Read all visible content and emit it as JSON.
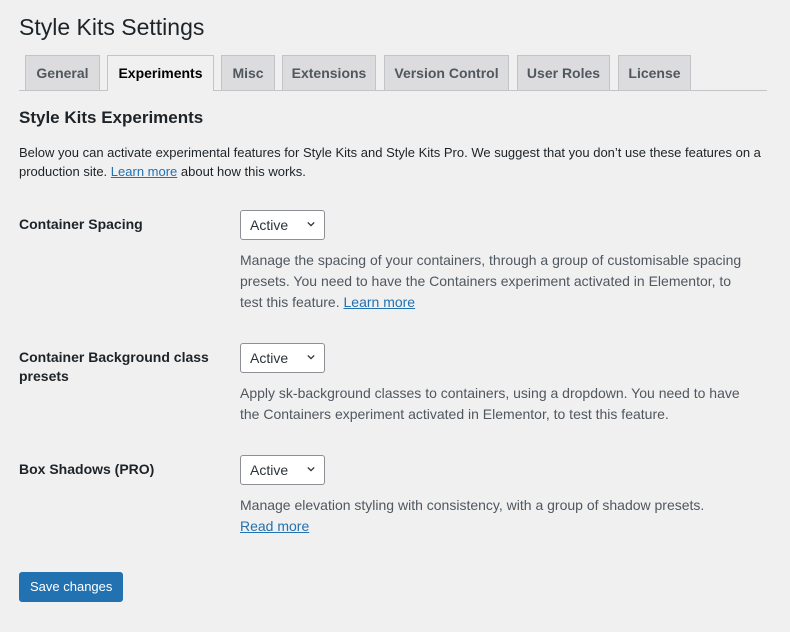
{
  "page": {
    "title": "Style Kits Settings"
  },
  "tabs": [
    {
      "label": "General"
    },
    {
      "label": "Experiments",
      "active": true
    },
    {
      "label": "Misc"
    },
    {
      "label": "Extensions"
    },
    {
      "label": "Version Control"
    },
    {
      "label": "User Roles"
    },
    {
      "label": "License"
    }
  ],
  "section": {
    "title": "Style Kits Experiments",
    "intro_text": "Below you can activate experimental features for Style Kits and Style Kits Pro. We suggest that you don’t use these features on a production site.",
    "intro_link": "Learn more",
    "intro_tail": "about how this works."
  },
  "settings": [
    {
      "label": "Container Spacing",
      "value": "Active",
      "description": "Manage the spacing of your containers, through a group of customisable spacing presets. You need to have the Containers experiment activated in Elementor, to test this feature.",
      "link": "Learn more"
    },
    {
      "label": "Container Background class presets",
      "value": "Active",
      "description": "Apply sk-background classes to containers, using a dropdown. You need to have the Containers experiment activated in Elementor, to test this feature.",
      "link": ""
    },
    {
      "label": "Box Shadows (PRO)",
      "value": "Active",
      "description": "Manage elevation styling with consistency, with a group of shadow presets.",
      "link": "Read more"
    }
  ],
  "actions": {
    "save_label": "Save changes"
  },
  "colors": {
    "accent": "#2271b1",
    "background": "#f0f0f1",
    "tab_inactive": "#dcdcde"
  }
}
